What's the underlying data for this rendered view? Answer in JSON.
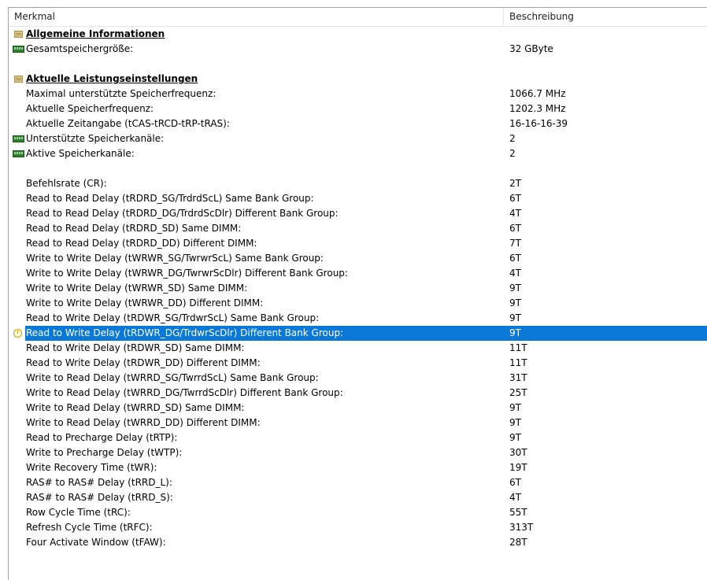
{
  "columns": {
    "feature": "Merkmal",
    "description": "Beschreibung"
  },
  "rows": [
    {
      "label": "Allgemeine Informationen",
      "value": "",
      "icon": "section-icon",
      "section": true
    },
    {
      "label": "Gesamtspeichergröße:",
      "value": "32 GByte",
      "icon": "memory-icon"
    },
    {
      "label": "",
      "value": ""
    },
    {
      "label": "Aktuelle Leistungseinstellungen",
      "value": "",
      "icon": "section-icon",
      "section": true
    },
    {
      "label": "Maximal unterstützte Speicherfrequenz:",
      "value": "1066.7 MHz"
    },
    {
      "label": "Aktuelle Speicherfrequenz:",
      "value": "1202.3 MHz"
    },
    {
      "label": "Aktuelle Zeitangabe (tCAS-tRCD-tRP-tRAS):",
      "value": "16-16-16-39"
    },
    {
      "label": "Unterstützte Speicherkanäle:",
      "value": "2",
      "icon": "memory-icon"
    },
    {
      "label": "Aktive Speicherkanäle:",
      "value": "2",
      "icon": "memory-icon"
    },
    {
      "label": "",
      "value": ""
    },
    {
      "label": "Befehlsrate (CR):",
      "value": "2T"
    },
    {
      "label": "Read to Read Delay (tRDRD_SG/TrdrdScL) Same Bank Group:",
      "value": "6T"
    },
    {
      "label": "Read to Read Delay (tRDRD_DG/TrdrdScDlr) Different Bank Group:",
      "value": "4T"
    },
    {
      "label": "Read to Read Delay (tRDRD_SD) Same DIMM:",
      "value": "6T"
    },
    {
      "label": "Read to Read Delay (tRDRD_DD) Different DIMM:",
      "value": "7T"
    },
    {
      "label": "Write to Write Delay (tWRWR_SG/TwrwrScL) Same Bank Group:",
      "value": "6T"
    },
    {
      "label": "Write to Write Delay (tWRWR_DG/TwrwrScDlr) Different Bank Group:",
      "value": "4T"
    },
    {
      "label": "Write to Write Delay (tWRWR_SD) Same DIMM:",
      "value": "9T"
    },
    {
      "label": "Write to Write Delay (tWRWR_DD) Different DIMM:",
      "value": "9T"
    },
    {
      "label": "Read to Write Delay (tRDWR_SG/TrdwrScL) Same Bank Group:",
      "value": "9T"
    },
    {
      "label": "Read to Write Delay (tRDWR_DG/TrdwrScDlr) Different Bank Group:",
      "value": "9T",
      "icon": "clock-icon",
      "selected": true
    },
    {
      "label": "Read to Write Delay (tRDWR_SD) Same DIMM:",
      "value": "11T"
    },
    {
      "label": "Read to Write Delay (tRDWR_DD) Different DIMM:",
      "value": "11T"
    },
    {
      "label": "Write to Read Delay (tWRRD_SG/TwrrdScL) Same Bank Group:",
      "value": "31T"
    },
    {
      "label": "Write to Read Delay (tWRRD_DG/TwrrdScDlr) Different Bank Group:",
      "value": "25T"
    },
    {
      "label": "Write to Read Delay (tWRRD_SD) Same DIMM:",
      "value": "9T"
    },
    {
      "label": "Write to Read Delay (tWRRD_DD) Different DIMM:",
      "value": "9T"
    },
    {
      "label": "Read to Precharge Delay (tRTP):",
      "value": "9T"
    },
    {
      "label": "Write to Precharge Delay (tWTP):",
      "value": "30T"
    },
    {
      "label": "Write Recovery Time (tWR):",
      "value": "19T"
    },
    {
      "label": "RAS# to RAS# Delay (tRRD_L):",
      "value": "6T"
    },
    {
      "label": "RAS# to RAS# Delay (tRRD_S):",
      "value": "4T"
    },
    {
      "label": "Row Cycle Time (tRC):",
      "value": "55T"
    },
    {
      "label": "Refresh Cycle Time (tRFC):",
      "value": "313T"
    },
    {
      "label": "Four Activate Window (tFAW):",
      "value": "28T"
    }
  ],
  "colors": {
    "selection": "#0a78d7",
    "selection_text": "#ffffff",
    "border": "#a0a0a0"
  }
}
